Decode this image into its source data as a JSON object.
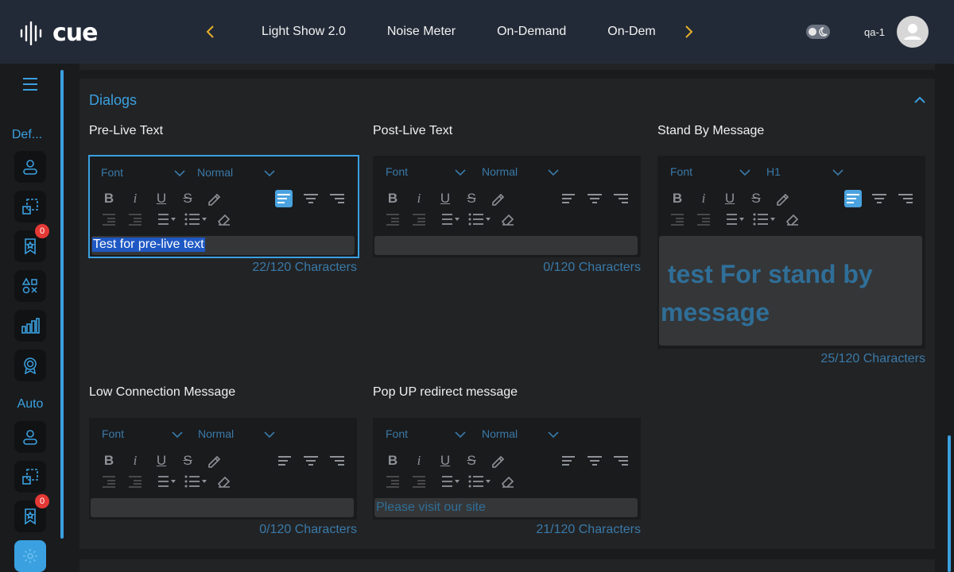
{
  "header": {
    "logo_text": "cue",
    "tabs": [
      "Light Show 2.0",
      "Noise Meter",
      "On-Demand",
      "On-Dem"
    ],
    "username": "qa-1",
    "accent_color": "#e7b02d"
  },
  "sidebar": {
    "menu_icon": "hamburger-icon",
    "group1_label": "Def...",
    "group2_label": "Auto",
    "badge_count_1": "0",
    "badge_count_2": "0"
  },
  "dialogs": {
    "title": "Dialogs",
    "editors": [
      {
        "label": "Pre-Live Text",
        "font": "Font",
        "size": "Normal",
        "content": "Test for pre-live text",
        "counter": "22/120 Characters"
      },
      {
        "label": "Post-Live Text",
        "font": "Font",
        "size": "Normal",
        "content": "",
        "counter": "0/120 Characters"
      },
      {
        "label": "Stand By Message",
        "font": "Font",
        "size": "H1",
        "content": " test For stand by message",
        "counter": "25/120 Characters"
      },
      {
        "label": "Low Connection Message",
        "font": "Font",
        "size": "Normal",
        "content": "",
        "counter": "0/120 Characters"
      },
      {
        "label": "Pop UP redirect message",
        "font": "Font",
        "size": "Normal",
        "content": "Please visit our site",
        "counter": "21/120 Characters"
      }
    ]
  },
  "colors": {
    "accent": "#3aa0e0",
    "badge": "#e53935"
  }
}
